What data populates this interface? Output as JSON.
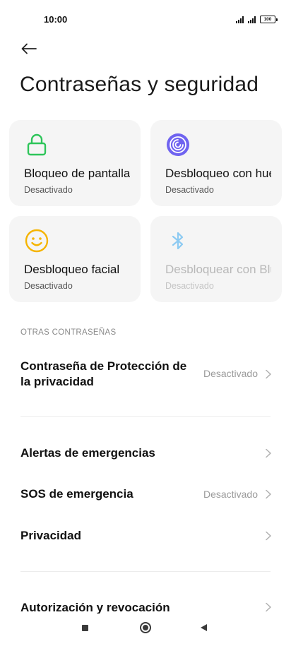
{
  "status_bar": {
    "time": "10:00",
    "battery": "100"
  },
  "header": {
    "title": "Contraseñas y seguridad"
  },
  "cards": [
    {
      "title": "Bloqueo de pantalla",
      "subtitle": "Desactivado",
      "icon": "lock-icon",
      "color": "#2ec55a"
    },
    {
      "title": "Desbloqueo con huella",
      "subtitle": "Desactivado",
      "icon": "fingerprint-icon",
      "color": "#6f63f0"
    },
    {
      "title": "Desbloqueo facial",
      "subtitle": "Desactivado",
      "icon": "face-icon",
      "color": "#f5b400"
    },
    {
      "title": "Desbloquear con Bluetooth",
      "subtitle": "Desactivado",
      "icon": "bluetooth-icon",
      "color": "#8ccaf2"
    }
  ],
  "section": {
    "other_passwords": "OTRAS CONTRASEÑAS"
  },
  "rows": {
    "privacy_password": {
      "label_line1": "Contraseña de Protección de",
      "label_line2": "la privacidad",
      "value": "Desactivado"
    },
    "emergency_alerts": {
      "label": "Alertas de emergencias"
    },
    "emergency_sos": {
      "label": "SOS de emergencia",
      "value": "Desactivado"
    },
    "privacy": {
      "label": "Privacidad"
    },
    "authorization": {
      "label": "Autorización y revocación"
    }
  }
}
